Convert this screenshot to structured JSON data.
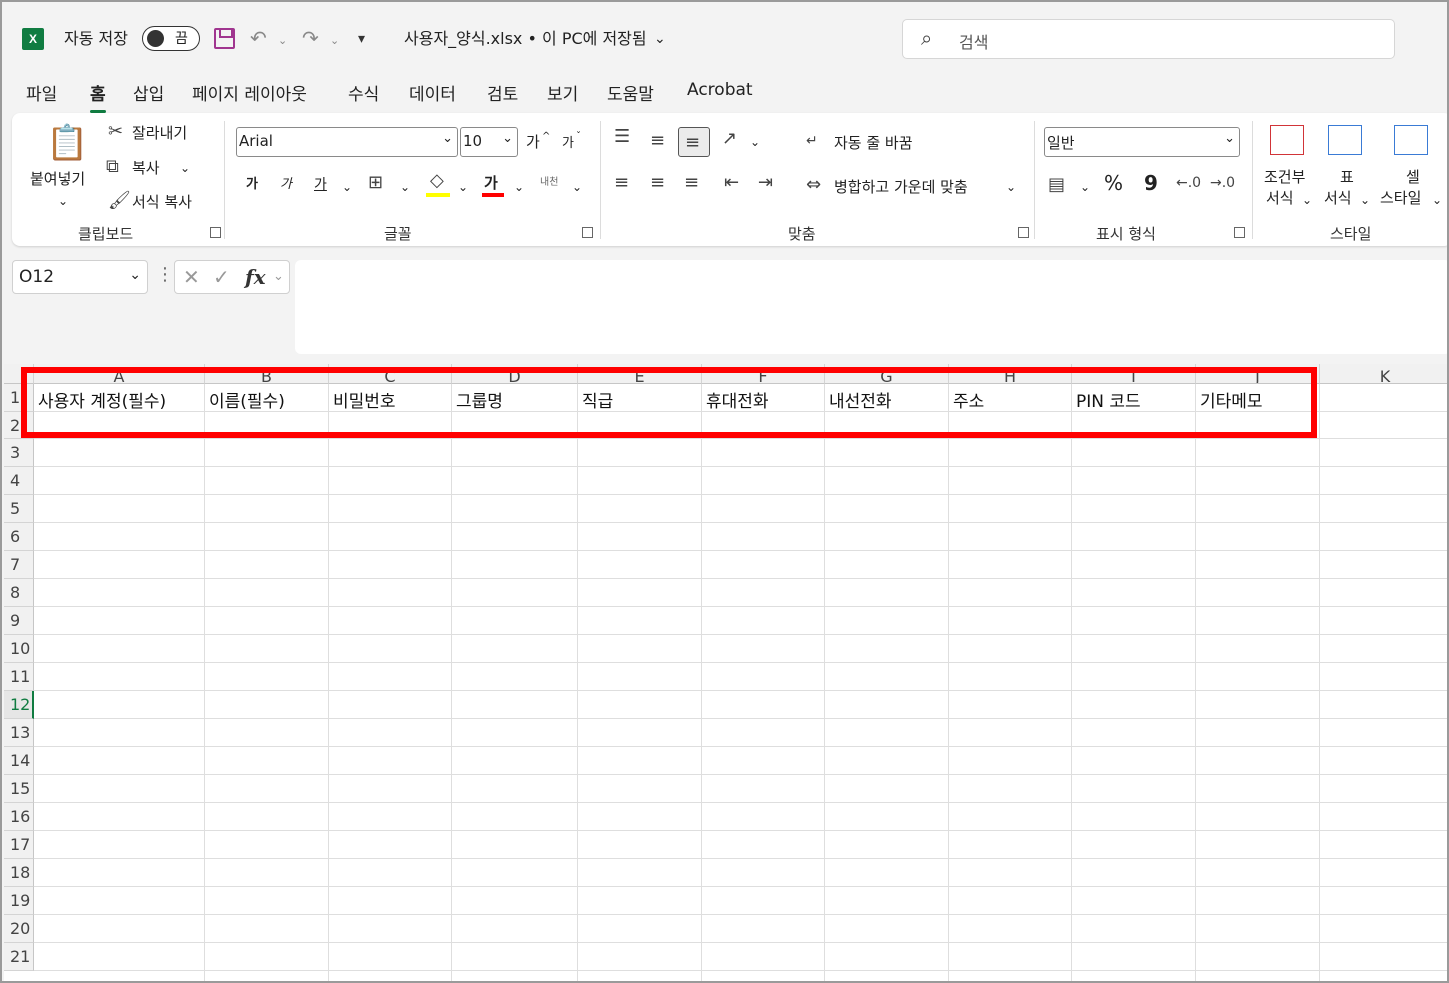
{
  "titlebar": {
    "app_logo": "X",
    "autosave_label": "자동 저장",
    "autosave_state": "끔",
    "file_title": "사용자_양식.xlsx • 이 PC에 저장됨",
    "search_placeholder": "검색",
    "icons": [
      "excel-logo",
      "save-icon",
      "undo-icon",
      "redo-icon",
      "customize-icon",
      "search-icon"
    ]
  },
  "tabs": [
    "파일",
    "홈",
    "삽입",
    "페이지 레이아웃",
    "수식",
    "데이터",
    "검토",
    "보기",
    "도움말",
    "Acrobat"
  ],
  "ribbon": {
    "clipboard": {
      "paste": "붙여넣기",
      "cut": "잘라내기",
      "copy": "복사",
      "format_painter": "서식 복사",
      "group_label": "클립보드"
    },
    "font": {
      "font_name": "Arial",
      "font_size": "10",
      "grow": "가",
      "shrink": "가",
      "bold": "가",
      "italic": "가",
      "underline": "가",
      "font_color": "가",
      "phonetic": "내천",
      "group_label": "글꼴",
      "fill_color": "#ffff00",
      "text_color": "#ff0000"
    },
    "alignment": {
      "wrap": "자동 줄 바꿈",
      "merge": "병합하고 가운데 맞춤",
      "group_label": "맞춤"
    },
    "number": {
      "format": "일반",
      "percent": "%",
      "comma": "9",
      "group_label": "표시 형식"
    },
    "styles": {
      "conditional_1": "조건부",
      "conditional_2": "서식",
      "table_1": "표",
      "table_2": "서식",
      "cell_1": "셀",
      "cell_2": "스타일",
      "group_label": "스타일"
    }
  },
  "formula_bar": {
    "name_box": "O12",
    "fx": "fx",
    "content": ""
  },
  "sheet": {
    "columns": [
      "A",
      "B",
      "C",
      "D",
      "E",
      "F",
      "G",
      "H",
      "I",
      "J",
      "K"
    ],
    "rows": [
      "1",
      "2",
      "3",
      "4",
      "5",
      "6",
      "7",
      "8",
      "9",
      "10",
      "11",
      "12",
      "13",
      "14",
      "15",
      "16",
      "17",
      "18",
      "19",
      "20",
      "21"
    ],
    "selected_row": "12",
    "row1": [
      "사용자 계정(필수)",
      "이름(필수)",
      "비밀번호",
      "그룹명",
      "직급",
      "휴대전화",
      "내선전화",
      "주소",
      "PIN 코드",
      "기타메모"
    ]
  },
  "colors": {
    "accent": "#107c41",
    "highlight_box": "#ff0000"
  }
}
